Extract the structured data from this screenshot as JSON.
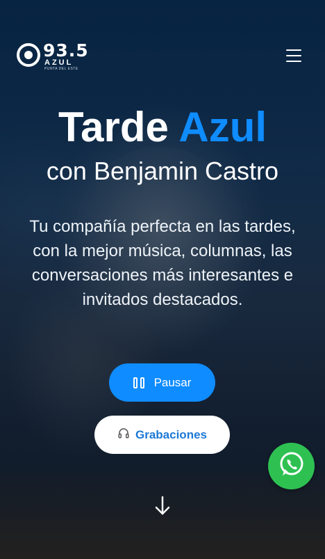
{
  "header": {
    "logo": {
      "frequency": "93.5",
      "name": "AZUL",
      "tagline": "PUNTA DEL ESTE"
    },
    "menu_icon": "hamburger-menu-icon"
  },
  "hero": {
    "title_part1": "Tarde",
    "title_part2": "Azul",
    "subtitle": "con Benjamin Castro",
    "description": "Tu compañía perfecta en las tardes, con la mejor música, columnas, las conversaciones más interesantes e invitados destacados."
  },
  "actions": {
    "pause_label": "Pausar",
    "pause_icon": "pause-icon",
    "recordings_label": "Grabaciones",
    "recordings_icon": "headphones-icon"
  },
  "scroll_icon": "arrow-down-icon",
  "whatsapp_icon": "whatsapp-icon",
  "colors": {
    "accent": "#0f8cff",
    "whatsapp": "#2ec152",
    "recordings_text": "#1c79d6"
  }
}
